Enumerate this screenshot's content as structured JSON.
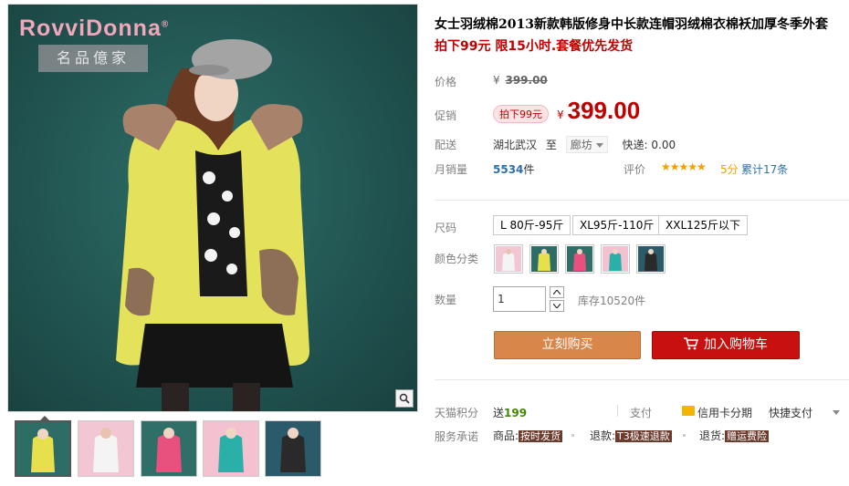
{
  "gallery": {
    "brand": "RovviDonna",
    "brand_mark": "®",
    "brand_sub": "名品億家",
    "zoom_icon": "magnifier-icon",
    "thumbnails": [
      {
        "name": "yellow",
        "color": "#e6e04c",
        "bg": "#2e6d66",
        "selected": true
      },
      {
        "name": "white",
        "color": "#f4f4f4",
        "bg": "#f2c6d2",
        "selected": false
      },
      {
        "name": "rose",
        "color": "#e8507e",
        "bg": "#2f6f68",
        "selected": false
      },
      {
        "name": "teal",
        "color": "#2ab0a8",
        "bg": "#f3c1cf",
        "selected": false
      },
      {
        "name": "black",
        "color": "#2a2a2a",
        "bg": "#2b5a6a",
        "selected": false
      }
    ]
  },
  "product": {
    "title": "女士羽绒棉2013新款韩版修身中长款连帽羽绒棉衣棉袄加厚冬季外套",
    "subtitle": "拍下99元 限15小时.套餐优先发货"
  },
  "price": {
    "label": "价格",
    "currency": "¥",
    "original": "399.00"
  },
  "promo": {
    "label": "促销",
    "tag": "拍下99元",
    "currency": "¥",
    "price": "399.00"
  },
  "shipping": {
    "label": "配送",
    "from": "湖北武汉",
    "to_word": "至",
    "city": "廊坊",
    "fee": "快递: 0.00"
  },
  "sales": {
    "label": "月销量",
    "count": "5534",
    "unit": "件",
    "review_label": "评价",
    "stars": "★★★★★",
    "score": "5分",
    "total": "累计17条"
  },
  "sizes": {
    "label": "尺码",
    "options": [
      "L 80斤-95斤",
      "XL95斤-110斤",
      "XXL125斤以下"
    ]
  },
  "colors": {
    "label": "颜色分类",
    "swatches": [
      {
        "name": "white",
        "color": "#f4f4f4",
        "bg": "#f2c6d2"
      },
      {
        "name": "yellow",
        "color": "#e6e04c",
        "bg": "#2e6d66"
      },
      {
        "name": "rose",
        "color": "#e8507e",
        "bg": "#2f6f68"
      },
      {
        "name": "teal",
        "color": "#2ab0a8",
        "bg": "#f3c1cf"
      },
      {
        "name": "black",
        "color": "#2a2a2a",
        "bg": "#2b5a6a"
      }
    ]
  },
  "quantity": {
    "label": "数量",
    "value": "1",
    "stock": "库存10520件"
  },
  "actions": {
    "buy_now": "立刻购买",
    "add_cart": "加入购物车"
  },
  "points": {
    "label": "天猫积分",
    "prefix": "送",
    "value": "199",
    "pay_label": "支付",
    "credit": "信用卡分期",
    "quick_pay": "快捷支付"
  },
  "service": {
    "label": "服务承诺",
    "items": [
      {
        "prefix": "商品:",
        "tag": "按时发货"
      },
      {
        "prefix": "退款:",
        "tag": "T3极速退款"
      },
      {
        "prefix": "退货:",
        "tag": "赠运费险"
      }
    ]
  },
  "theme": {
    "accent_red": "#c00000",
    "buy_orange": "#d9864a",
    "cart_red": "#c8100e",
    "link_blue": "#2f6ea6"
  }
}
